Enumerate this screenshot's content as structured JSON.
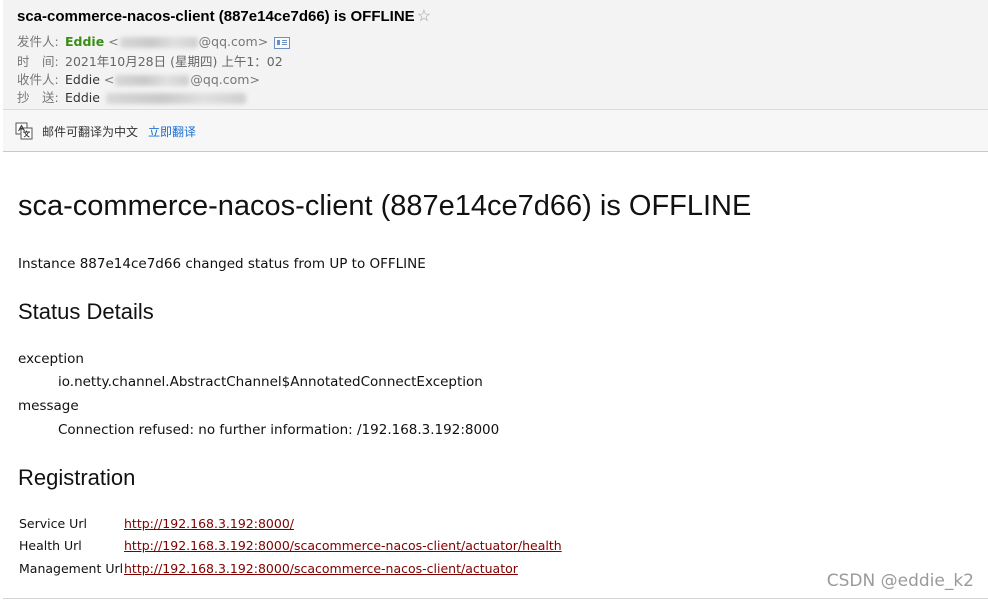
{
  "header": {
    "subject": "sca-commerce-nacos-client (887e14ce7d66) is OFFLINE",
    "star_icon": "☆",
    "from_label": "发件人:",
    "from_name": "Eddie",
    "from_email_open": "<",
    "from_email_domain": "@qq.com>",
    "time_label": "时　间:",
    "time_value": "2021年10月28日 (星期四) 上午1：02",
    "to_label": "收件人:",
    "to_name": "Eddie",
    "to_email_open": "<",
    "to_email_domain": "@qq.com>",
    "cc_label": "抄　送:",
    "cc_name": "Eddie"
  },
  "translate": {
    "text": "邮件可翻译为中文",
    "link": "立即翻译"
  },
  "body": {
    "title": "sca-commerce-nacos-client (887e14ce7d66) is OFFLINE",
    "intro": "Instance 887e14ce7d66 changed status from UP to OFFLINE",
    "status_heading": "Status Details",
    "details": [
      {
        "term": "exception",
        "value": "io.netty.channel.AbstractChannel$AnnotatedConnectException"
      },
      {
        "term": "message",
        "value": "Connection refused: no further information: /192.168.3.192:8000"
      }
    ],
    "registration_heading": "Registration",
    "registration": [
      {
        "label": "Service Url",
        "url": "http://192.168.3.192:8000/"
      },
      {
        "label": "Health Url",
        "url": "http://192.168.3.192:8000/scacommerce-nacos-client/actuator/health"
      },
      {
        "label": "Management Url",
        "url": "http://192.168.3.192:8000/scacommerce-nacos-client/actuator"
      }
    ]
  },
  "watermark": "CSDN @eddie_k2"
}
